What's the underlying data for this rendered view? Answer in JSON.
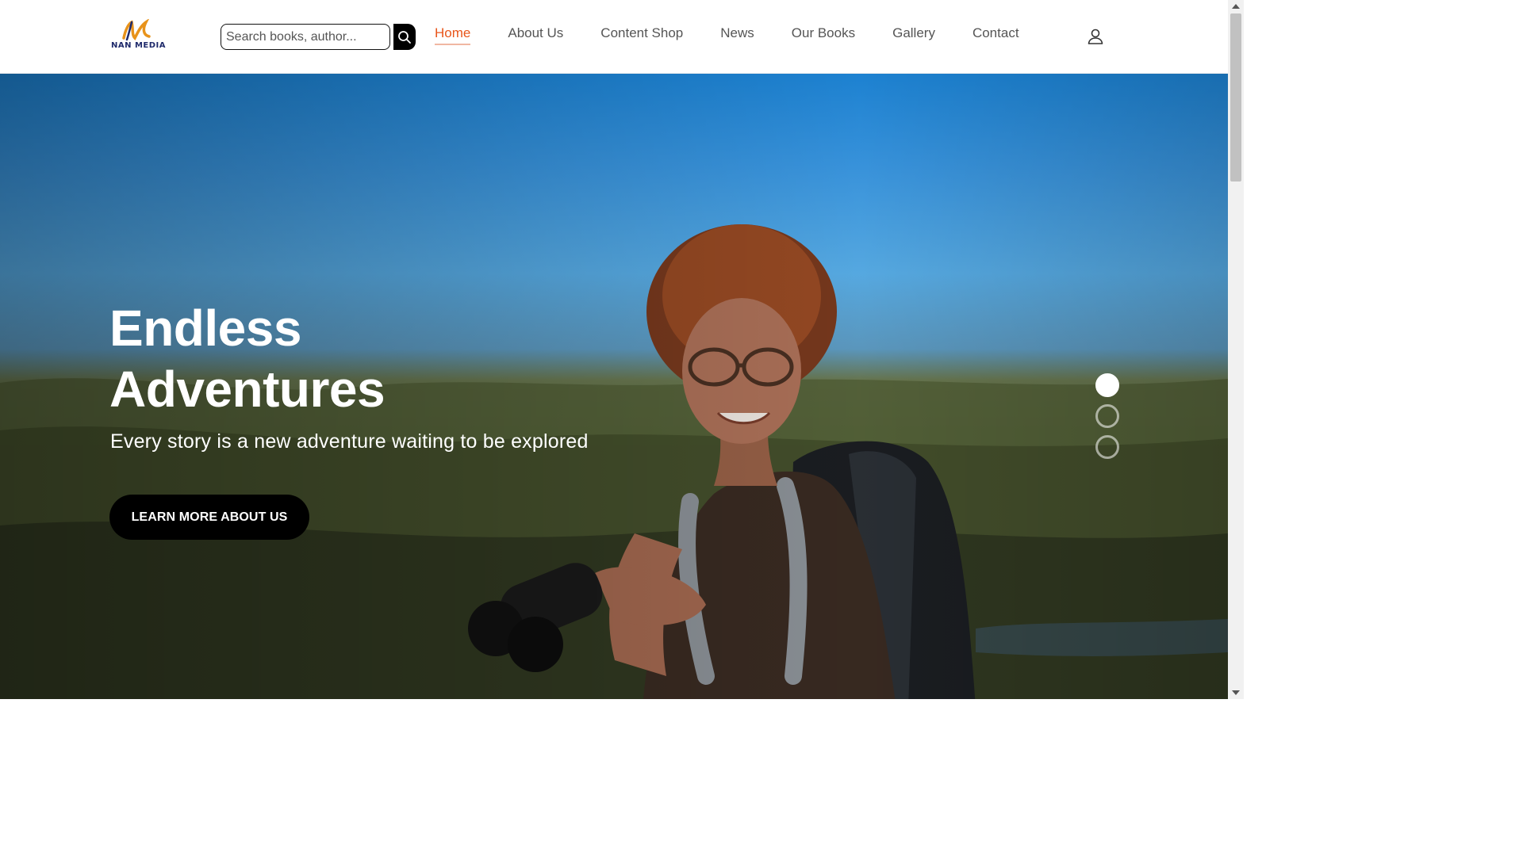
{
  "header": {
    "logo_text": "NAN MEDIA",
    "search": {
      "placeholder": "Search books, author..."
    },
    "nav": [
      {
        "label": "Home",
        "active": true
      },
      {
        "label": "About Us"
      },
      {
        "label": "Content Shop"
      },
      {
        "label": "News"
      },
      {
        "label": "Our Books"
      },
      {
        "label": "Gallery"
      },
      {
        "label": "Contact"
      }
    ],
    "icons": {
      "search": "search-icon",
      "user": "user-icon"
    }
  },
  "hero": {
    "title": "Endless Adventures",
    "subtitle": "Every story is a new adventure waiting to be explored",
    "cta_label": "LEARN MORE ABOUT US",
    "slides": {
      "count": 3,
      "active_index": 0
    }
  },
  "colors": {
    "accent": "#e8561b",
    "button_bg": "#000000",
    "sky": "#4fa8ea"
  }
}
